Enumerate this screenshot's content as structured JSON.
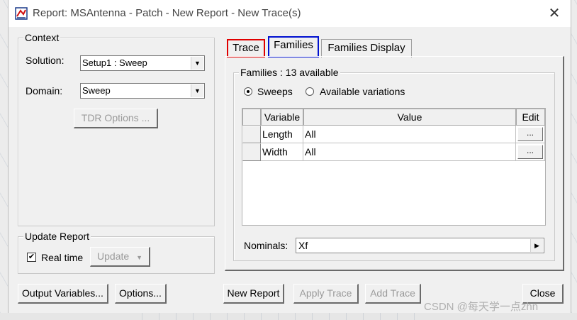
{
  "window": {
    "title": "Report: MSAntenna - Patch - New Report - New Trace(s)"
  },
  "context": {
    "label": "Context",
    "solution_label": "Solution:",
    "solution_value": "Setup1 : Sweep",
    "domain_label": "Domain:",
    "domain_value": "Sweep",
    "tdr_button": "TDR Options ..."
  },
  "update_report": {
    "label": "Update Report",
    "realtime_label": "Real time",
    "realtime_checked": true,
    "update_button": "Update"
  },
  "tabs": [
    {
      "label": "Trace",
      "highlight": "#e00000"
    },
    {
      "label": "Families",
      "highlight": "#0010d0"
    },
    {
      "label": "Families Display"
    }
  ],
  "families": {
    "group_label": "Families : 13 available",
    "radio_sweeps": "Sweeps",
    "radio_available": "Available variations",
    "selected": "Sweeps",
    "columns": [
      "Variable",
      "Value",
      "Edit"
    ],
    "rows": [
      {
        "variable": "Length",
        "value": "All",
        "edit": "..."
      },
      {
        "variable": "Width",
        "value": "All",
        "edit": "..."
      }
    ],
    "nominals_label": "Nominals:",
    "nominals_value": "Xf"
  },
  "buttons": {
    "output_variables": "Output Variables...",
    "options": "Options...",
    "new_report": "New Report",
    "apply_trace": "Apply Trace",
    "add_trace": "Add Trace",
    "close": "Close"
  },
  "watermark": "CSDN @每天学一点zhn"
}
